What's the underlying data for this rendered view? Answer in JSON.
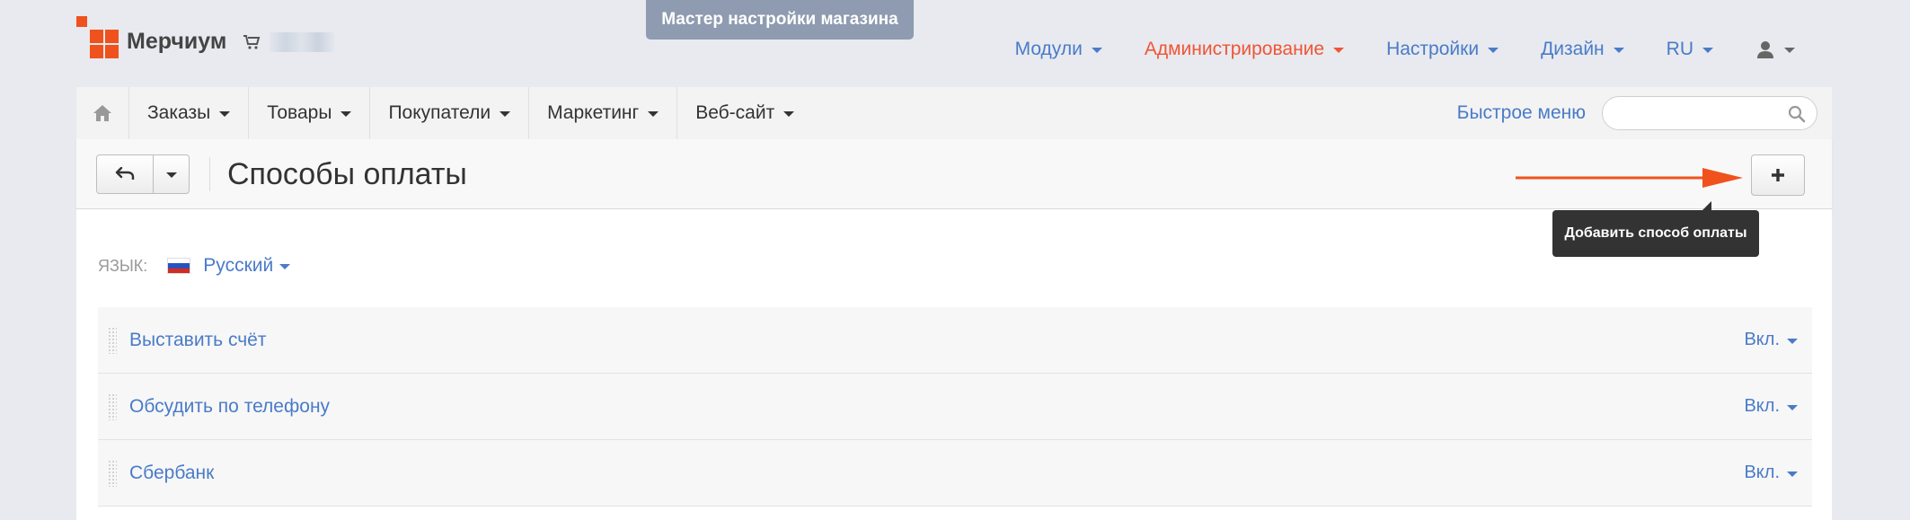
{
  "wizard": {
    "label": "Мастер настройки магазина"
  },
  "brand": {
    "name": "Мерчиум",
    "logo_icon": "merchium-logo-icon",
    "cart_icon": "cart-icon"
  },
  "top_nav": {
    "items": [
      {
        "label": "Модули",
        "color": "#4a7bc8"
      },
      {
        "label": "Администрирование",
        "color": "#ef5536"
      },
      {
        "label": "Настройки",
        "color": "#4a7bc8"
      },
      {
        "label": "Дизайн",
        "color": "#4a7bc8"
      },
      {
        "label": "RU",
        "color": "#4a7bc8"
      }
    ],
    "user_icon": "user-icon"
  },
  "main_nav": {
    "home_icon": "home-icon",
    "items": [
      {
        "label": "Заказы"
      },
      {
        "label": "Товары"
      },
      {
        "label": "Покупатели"
      },
      {
        "label": "Маркетинг"
      },
      {
        "label": "Веб-сайт"
      }
    ],
    "quick_menu_label": "Быстрое меню",
    "search": {
      "value": "",
      "placeholder": "",
      "icon": "search-icon"
    }
  },
  "toolbar": {
    "back_icon": "back-arrow-icon",
    "title": "Способы оплаты",
    "add_icon": "plus-icon",
    "add_tooltip": "Добавить способ оплаты",
    "annotation_arrow_color": "#f0521d"
  },
  "language": {
    "label": "ЯЗЫК:",
    "value": "Русский",
    "flag_icon": "russian-flag-icon"
  },
  "payment_methods": [
    {
      "name": "Выставить счёт",
      "status": "Вкл."
    },
    {
      "name": "Обсудить по телефону",
      "status": "Вкл."
    },
    {
      "name": "Сбербанк",
      "status": "Вкл."
    }
  ],
  "colors": {
    "accent": "#4a7bc8",
    "brand": "#f0521d",
    "admin": "#ef5536"
  }
}
